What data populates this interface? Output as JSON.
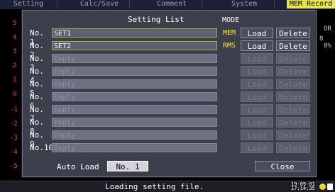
{
  "tabs": [
    {
      "label": "Setting",
      "active": false
    },
    {
      "label": "Calc/Save",
      "active": false
    },
    {
      "label": "Comment",
      "active": false
    },
    {
      "label": "System",
      "active": false
    },
    {
      "label": "MEM Record",
      "active": true
    }
  ],
  "left_edge_labels": [
    "5",
    "4",
    "3",
    "2",
    "1",
    "0",
    "-1",
    "-2",
    "-3",
    "-4",
    "-5"
  ],
  "right_edge": {
    "top": "OR",
    "mid": "8",
    "bottom": "0%"
  },
  "dialog": {
    "title": "Setting List",
    "mode_header": "MODE",
    "rows": [
      {
        "no": "No. 1",
        "name": "SET1",
        "mode": "MEM",
        "load": "Load",
        "delete": "Delete",
        "enabled": true
      },
      {
        "no": "No. 2",
        "name": "SET2",
        "mode": "RMS",
        "load": "Load",
        "delete": "Delete",
        "enabled": true
      },
      {
        "no": "No. 3",
        "name": "Empty",
        "mode": "",
        "load": "Load",
        "delete": "Delete",
        "enabled": false
      },
      {
        "no": "No. 4",
        "name": "Empty",
        "mode": "",
        "load": "Load",
        "delete": "Delete",
        "enabled": false
      },
      {
        "no": "No. 5",
        "name": "Empty",
        "mode": "",
        "load": "Load",
        "delete": "Delete",
        "enabled": false
      },
      {
        "no": "No. 6",
        "name": "Empty",
        "mode": "",
        "load": "Load",
        "delete": "Delete",
        "enabled": false
      },
      {
        "no": "No. 7",
        "name": "Empty",
        "mode": "",
        "load": "Load",
        "delete": "Delete",
        "enabled": false
      },
      {
        "no": "No. 8",
        "name": "Empty",
        "mode": "",
        "load": "Load",
        "delete": "Delete",
        "enabled": false
      },
      {
        "no": "No. 9",
        "name": "Empty",
        "mode": "",
        "load": "Load",
        "delete": "Delete",
        "enabled": false
      },
      {
        "no": "No.10",
        "name": "Empty",
        "mode": "",
        "load": "Load",
        "delete": "Delete",
        "enabled": false
      }
    ],
    "auto_load_label": "Auto Load",
    "auto_load_value": "No. 1",
    "close_label": "Close"
  },
  "status": {
    "message": "Loading setting file.",
    "date": "19-09-01",
    "time": "17:14:35",
    "icons": [
      "power-icon",
      "memory-card-icon"
    ],
    "colors": {
      "power": "#e8e020",
      "card": "#ffffff"
    }
  }
}
